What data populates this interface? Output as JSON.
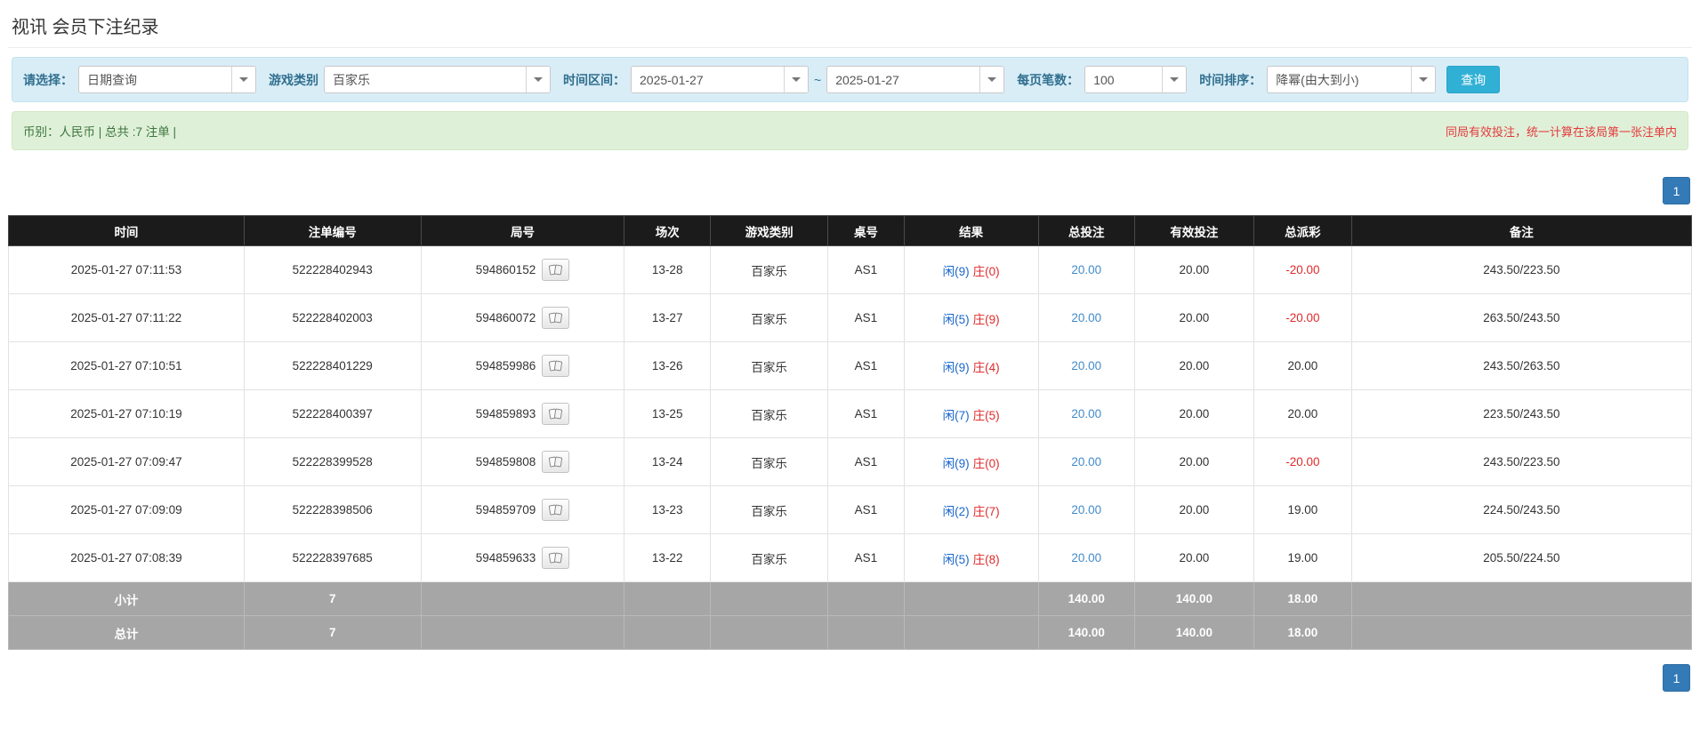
{
  "page": {
    "title": "视讯 会员下注纪录"
  },
  "filters": {
    "select_label": "请选择：",
    "select_value": "日期查询",
    "game_label": "游戏类别",
    "game_value": "百家乐",
    "range_label": "时间区间：",
    "range_from": "2025-01-27",
    "range_tilde": "~",
    "range_to": "2025-01-27",
    "pagesize_label": "每页笔数：",
    "pagesize_value": "100",
    "sort_label": "时间排序：",
    "sort_value": "降幂(由大到小)",
    "search_button": "查询"
  },
  "summary": {
    "left": "币别：人民币 | 总共 :7 注单 |",
    "right": "同局有效投注，统一计算在该局第一张注单内"
  },
  "pagination": {
    "page": "1"
  },
  "table": {
    "headers": [
      "时间",
      "注单编号",
      "局号",
      "场次",
      "游戏类别",
      "桌号",
      "结果",
      "总投注",
      "有效投注",
      "总派彩",
      "备注"
    ],
    "rows": [
      {
        "time": "2025-01-27 07:11:53",
        "bet_id": "522228402943",
        "round_id": "594860152",
        "session": "13-28",
        "game": "百家乐",
        "table_no": "AS1",
        "result_player": "闲(9)",
        "result_banker": "庄(0)",
        "total_bet": "20.00",
        "valid_bet": "20.00",
        "payout": "-20.00",
        "remark": "243.50/223.50"
      },
      {
        "time": "2025-01-27 07:11:22",
        "bet_id": "522228402003",
        "round_id": "594860072",
        "session": "13-27",
        "game": "百家乐",
        "table_no": "AS1",
        "result_player": "闲(5)",
        "result_banker": "庄(9)",
        "total_bet": "20.00",
        "valid_bet": "20.00",
        "payout": "-20.00",
        "remark": "263.50/243.50"
      },
      {
        "time": "2025-01-27 07:10:51",
        "bet_id": "522228401229",
        "round_id": "594859986",
        "session": "13-26",
        "game": "百家乐",
        "table_no": "AS1",
        "result_player": "闲(9)",
        "result_banker": "庄(4)",
        "total_bet": "20.00",
        "valid_bet": "20.00",
        "payout": "20.00",
        "remark": "243.50/263.50"
      },
      {
        "time": "2025-01-27 07:10:19",
        "bet_id": "522228400397",
        "round_id": "594859893",
        "session": "13-25",
        "game": "百家乐",
        "table_no": "AS1",
        "result_player": "闲(7)",
        "result_banker": "庄(5)",
        "total_bet": "20.00",
        "valid_bet": "20.00",
        "payout": "20.00",
        "remark": "223.50/243.50"
      },
      {
        "time": "2025-01-27 07:09:47",
        "bet_id": "522228399528",
        "round_id": "594859808",
        "session": "13-24",
        "game": "百家乐",
        "table_no": "AS1",
        "result_player": "闲(9)",
        "result_banker": "庄(0)",
        "total_bet": "20.00",
        "valid_bet": "20.00",
        "payout": "-20.00",
        "remark": "243.50/223.50"
      },
      {
        "time": "2025-01-27 07:09:09",
        "bet_id": "522228398506",
        "round_id": "594859709",
        "session": "13-23",
        "game": "百家乐",
        "table_no": "AS1",
        "result_player": "闲(2)",
        "result_banker": "庄(7)",
        "total_bet": "20.00",
        "valid_bet": "20.00",
        "payout": "19.00",
        "remark": "224.50/243.50"
      },
      {
        "time": "2025-01-27 07:08:39",
        "bet_id": "522228397685",
        "round_id": "594859633",
        "session": "13-22",
        "game": "百家乐",
        "table_no": "AS1",
        "result_player": "闲(5)",
        "result_banker": "庄(8)",
        "total_bet": "20.00",
        "valid_bet": "20.00",
        "payout": "19.00",
        "remark": "205.50/224.50"
      }
    ],
    "subtotal": {
      "label": "小计",
      "count": "7",
      "total_bet": "140.00",
      "valid_bet": "140.00",
      "payout": "18.00"
    },
    "total": {
      "label": "总计",
      "count": "7",
      "total_bet": "140.00",
      "valid_bet": "140.00",
      "payout": "18.00"
    }
  }
}
